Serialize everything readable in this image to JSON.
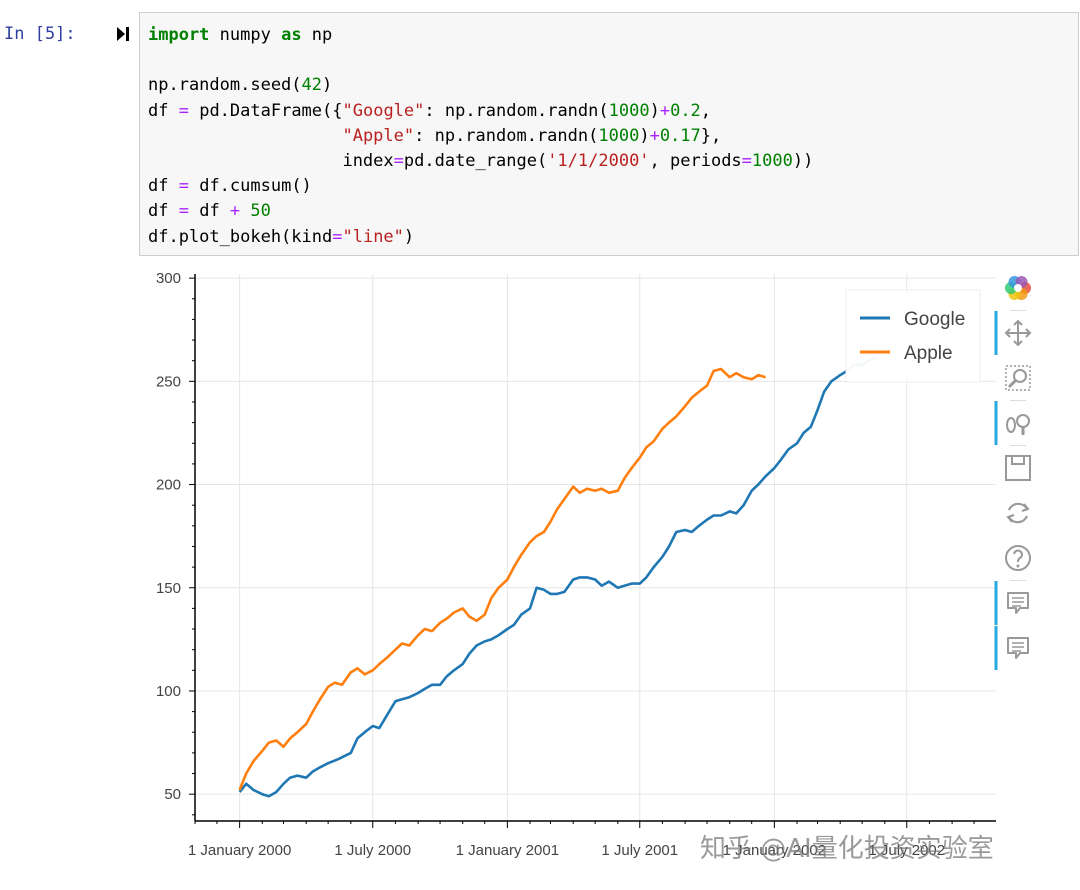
{
  "cell": {
    "prompt": "In  [5]:",
    "code_lines": [
      [
        {
          "t": "import",
          "c": "kw"
        },
        {
          "t": " numpy "
        },
        {
          "t": "as",
          "c": "kw"
        },
        {
          "t": " np"
        }
      ],
      [],
      [
        {
          "t": "np.random.seed("
        },
        {
          "t": "42",
          "c": "num"
        },
        {
          "t": ")"
        }
      ],
      [
        {
          "t": "df "
        },
        {
          "t": "=",
          "c": "op"
        },
        {
          "t": " pd.DataFrame({"
        },
        {
          "t": "\"Google\"",
          "c": "str"
        },
        {
          "t": ": np.random.randn("
        },
        {
          "t": "1000",
          "c": "num"
        },
        {
          "t": ")"
        },
        {
          "t": "+",
          "c": "op"
        },
        {
          "t": "0.2",
          "c": "num"
        },
        {
          "t": ","
        }
      ],
      [
        {
          "t": "                   "
        },
        {
          "t": "\"Apple\"",
          "c": "str"
        },
        {
          "t": ": np.random.randn("
        },
        {
          "t": "1000",
          "c": "num"
        },
        {
          "t": ")"
        },
        {
          "t": "+",
          "c": "op"
        },
        {
          "t": "0.17",
          "c": "num"
        },
        {
          "t": "},"
        }
      ],
      [
        {
          "t": "                   index"
        },
        {
          "t": "=",
          "c": "op"
        },
        {
          "t": "pd.date_range("
        },
        {
          "t": "'1/1/2000'",
          "c": "str"
        },
        {
          "t": ", periods"
        },
        {
          "t": "=",
          "c": "op"
        },
        {
          "t": "1000",
          "c": "num"
        },
        {
          "t": "))"
        }
      ],
      [
        {
          "t": "df "
        },
        {
          "t": "=",
          "c": "op"
        },
        {
          "t": " df.cumsum()"
        }
      ],
      [
        {
          "t": "df "
        },
        {
          "t": "=",
          "c": "op"
        },
        {
          "t": " df "
        },
        {
          "t": "+",
          "c": "op"
        },
        {
          "t": " "
        },
        {
          "t": "50",
          "c": "num"
        }
      ],
      [
        {
          "t": "df.plot_bokeh(kind"
        },
        {
          "t": "=",
          "c": "op"
        },
        {
          "t": "\"line\"",
          "c": "str"
        },
        {
          "t": ")"
        }
      ]
    ]
  },
  "chart_data": {
    "type": "line",
    "title": "",
    "xlabel": "",
    "ylabel": "",
    "x_range": [
      "1999-11-01",
      "2002-10-31"
    ],
    "ylim": [
      37,
      302
    ],
    "grid": true,
    "legend_position": "top-right",
    "y_ticks": [
      50,
      100,
      150,
      200,
      250,
      300
    ],
    "x_ticks": [
      {
        "date": "2000-01-01",
        "label": "1 January 2000"
      },
      {
        "date": "2000-07-01",
        "label": "1 July 2000"
      },
      {
        "date": "2001-01-01",
        "label": "1 January 2001"
      },
      {
        "date": "2001-07-01",
        "label": "1 July 2001"
      },
      {
        "date": "2002-01-01",
        "label": "1 January 2002"
      },
      {
        "date": "2002-07-01",
        "label": "1 July 2002"
      }
    ],
    "series": [
      {
        "name": "Google",
        "color": "#1f77b4",
        "points": [
          [
            "2000-01-01",
            51
          ],
          [
            "2000-01-10",
            55
          ],
          [
            "2000-01-20",
            52
          ],
          [
            "2000-02-01",
            50
          ],
          [
            "2000-02-10",
            49
          ],
          [
            "2000-02-20",
            51
          ],
          [
            "2000-03-01",
            55
          ],
          [
            "2000-03-10",
            58
          ],
          [
            "2000-03-20",
            59
          ],
          [
            "2000-04-01",
            58
          ],
          [
            "2000-04-10",
            61
          ],
          [
            "2000-04-20",
            63
          ],
          [
            "2000-05-01",
            65
          ],
          [
            "2000-05-15",
            67
          ],
          [
            "2000-06-01",
            70
          ],
          [
            "2000-06-10",
            77
          ],
          [
            "2000-06-20",
            80
          ],
          [
            "2000-07-01",
            83
          ],
          [
            "2000-07-10",
            82
          ],
          [
            "2000-07-20",
            88
          ],
          [
            "2000-08-01",
            95
          ],
          [
            "2000-08-10",
            96
          ],
          [
            "2000-08-20",
            97
          ],
          [
            "2000-09-01",
            99
          ],
          [
            "2000-09-10",
            101
          ],
          [
            "2000-09-20",
            103
          ],
          [
            "2000-10-01",
            103
          ],
          [
            "2000-10-10",
            107
          ],
          [
            "2000-10-20",
            110
          ],
          [
            "2000-11-01",
            113
          ],
          [
            "2000-11-10",
            118
          ],
          [
            "2000-11-20",
            122
          ],
          [
            "2000-12-01",
            124
          ],
          [
            "2000-12-10",
            125
          ],
          [
            "2000-12-20",
            127
          ],
          [
            "2001-01-01",
            130
          ],
          [
            "2001-01-10",
            132
          ],
          [
            "2001-01-20",
            137
          ],
          [
            "2001-02-01",
            140
          ],
          [
            "2001-02-10",
            150
          ],
          [
            "2001-02-20",
            149
          ],
          [
            "2001-03-01",
            147
          ],
          [
            "2001-03-10",
            147
          ],
          [
            "2001-03-20",
            148
          ],
          [
            "2001-04-01",
            154
          ],
          [
            "2001-04-10",
            155
          ],
          [
            "2001-04-20",
            155
          ],
          [
            "2001-05-01",
            154
          ],
          [
            "2001-05-10",
            151
          ],
          [
            "2001-05-20",
            153
          ],
          [
            "2001-06-01",
            150
          ],
          [
            "2001-06-10",
            151
          ],
          [
            "2001-06-20",
            152
          ],
          [
            "2001-07-01",
            152
          ],
          [
            "2001-07-10",
            155
          ],
          [
            "2001-07-20",
            160
          ],
          [
            "2001-08-01",
            165
          ],
          [
            "2001-08-10",
            170
          ],
          [
            "2001-08-20",
            177
          ],
          [
            "2001-09-01",
            178
          ],
          [
            "2001-09-10",
            177
          ],
          [
            "2001-09-20",
            180
          ],
          [
            "2001-10-01",
            183
          ],
          [
            "2001-10-10",
            185
          ],
          [
            "2001-10-20",
            185
          ],
          [
            "2001-11-01",
            187
          ],
          [
            "2001-11-10",
            186
          ],
          [
            "2001-11-20",
            190
          ],
          [
            "2001-12-01",
            197
          ],
          [
            "2001-12-10",
            200
          ],
          [
            "2001-12-20",
            204
          ],
          [
            "2002-01-01",
            208
          ],
          [
            "2002-01-10",
            212
          ],
          [
            "2002-01-20",
            217
          ],
          [
            "2002-02-01",
            220
          ],
          [
            "2002-02-10",
            225
          ],
          [
            "2002-02-20",
            228
          ],
          [
            "2002-03-01",
            236
          ],
          [
            "2002-03-10",
            245
          ],
          [
            "2002-03-20",
            250
          ],
          [
            "2002-04-01",
            253
          ],
          [
            "2002-04-10",
            255
          ],
          [
            "2002-04-20",
            258
          ],
          [
            "2002-05-01",
            258
          ],
          [
            "2002-05-10",
            260
          ],
          [
            "2002-05-20",
            262
          ]
        ]
      },
      {
        "name": "Apple",
        "color": "#ff7f0e",
        "points": [
          [
            "2000-01-01",
            52
          ],
          [
            "2000-01-10",
            60
          ],
          [
            "2000-01-20",
            66
          ],
          [
            "2000-02-01",
            71
          ],
          [
            "2000-02-10",
            75
          ],
          [
            "2000-02-20",
            76
          ],
          [
            "2000-03-01",
            73
          ],
          [
            "2000-03-10",
            77
          ],
          [
            "2000-03-20",
            80
          ],
          [
            "2000-04-01",
            84
          ],
          [
            "2000-04-10",
            90
          ],
          [
            "2000-04-20",
            96
          ],
          [
            "2000-05-01",
            102
          ],
          [
            "2000-05-10",
            104
          ],
          [
            "2000-05-20",
            103
          ],
          [
            "2000-06-01",
            109
          ],
          [
            "2000-06-10",
            111
          ],
          [
            "2000-06-20",
            108
          ],
          [
            "2000-07-01",
            110
          ],
          [
            "2000-07-10",
            113
          ],
          [
            "2000-07-20",
            116
          ],
          [
            "2000-08-01",
            120
          ],
          [
            "2000-08-10",
            123
          ],
          [
            "2000-08-20",
            122
          ],
          [
            "2000-09-01",
            127
          ],
          [
            "2000-09-10",
            130
          ],
          [
            "2000-09-20",
            129
          ],
          [
            "2000-10-01",
            133
          ],
          [
            "2000-10-10",
            135
          ],
          [
            "2000-10-20",
            138
          ],
          [
            "2000-11-01",
            140
          ],
          [
            "2000-11-10",
            136
          ],
          [
            "2000-11-20",
            134
          ],
          [
            "2000-12-01",
            137
          ],
          [
            "2000-12-10",
            145
          ],
          [
            "2000-12-20",
            150
          ],
          [
            "2001-01-01",
            154
          ],
          [
            "2001-01-10",
            160
          ],
          [
            "2001-01-20",
            166
          ],
          [
            "2001-02-01",
            172
          ],
          [
            "2001-02-10",
            175
          ],
          [
            "2001-02-20",
            177
          ],
          [
            "2001-03-01",
            182
          ],
          [
            "2001-03-10",
            188
          ],
          [
            "2001-03-20",
            193
          ],
          [
            "2001-04-01",
            199
          ],
          [
            "2001-04-10",
            196
          ],
          [
            "2001-04-20",
            198
          ],
          [
            "2001-05-01",
            197
          ],
          [
            "2001-05-10",
            198
          ],
          [
            "2001-05-20",
            196
          ],
          [
            "2001-06-01",
            197
          ],
          [
            "2001-06-10",
            203
          ],
          [
            "2001-06-20",
            208
          ],
          [
            "2001-07-01",
            213
          ],
          [
            "2001-07-10",
            218
          ],
          [
            "2001-07-20",
            221
          ],
          [
            "2001-08-01",
            227
          ],
          [
            "2001-08-10",
            230
          ],
          [
            "2001-08-20",
            233
          ],
          [
            "2001-09-01",
            238
          ],
          [
            "2001-09-10",
            242
          ],
          [
            "2001-09-20",
            245
          ],
          [
            "2001-10-01",
            248
          ],
          [
            "2001-10-10",
            255
          ],
          [
            "2001-10-20",
            256
          ],
          [
            "2001-11-01",
            252
          ],
          [
            "2001-11-10",
            254
          ],
          [
            "2001-11-20",
            252
          ],
          [
            "2001-12-01",
            251
          ],
          [
            "2001-12-10",
            253
          ],
          [
            "2001-12-20",
            252
          ]
        ]
      }
    ]
  },
  "toolbar": {
    "tools": [
      {
        "icon": "bokeh-logo-icon",
        "active": false
      },
      {
        "icon": "pan-icon",
        "active": true
      },
      {
        "icon": "box-zoom-icon",
        "active": false
      },
      {
        "icon": "wheel-zoom-icon",
        "active": true
      },
      {
        "icon": "save-icon",
        "active": false
      },
      {
        "icon": "reset-icon",
        "active": false
      },
      {
        "icon": "help-icon",
        "active": false
      },
      {
        "icon": "hover-icon",
        "active": true
      },
      {
        "icon": "hover-icon",
        "active": true
      }
    ]
  },
  "watermark": "知乎 @AI量化投资实验室"
}
